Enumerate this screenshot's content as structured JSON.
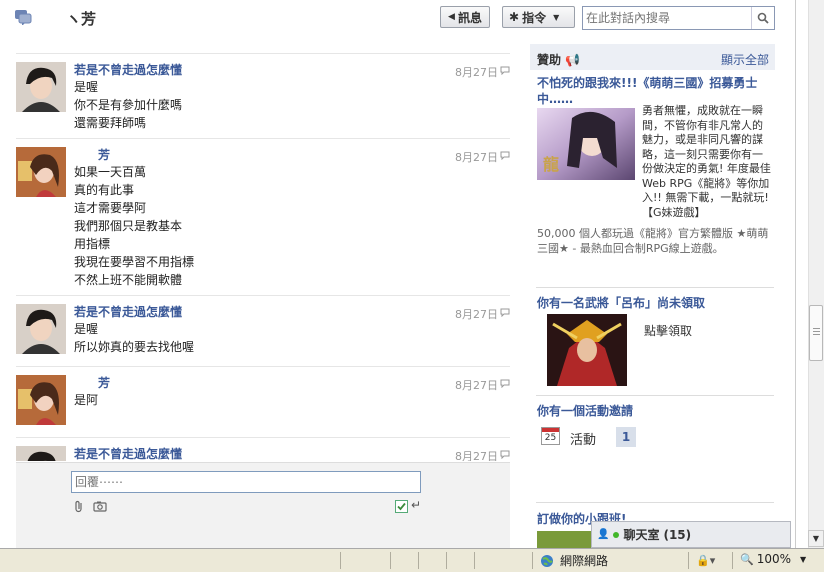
{
  "header": {
    "title": "ヽ芳",
    "message_button": "訊息",
    "actions_button": "指令",
    "search_placeholder": "在此對話內搜尋"
  },
  "messages": [
    {
      "sender": "若是不曾走過怎麼懂",
      "time": "8月27日",
      "avatar": "boy",
      "lines": [
        "是喔",
        "你不是有參加什麼嗎",
        "還需要拜師嗎"
      ]
    },
    {
      "sender": "芳",
      "time": "8月27日",
      "avatar": "girl",
      "lines": [
        "如果一天百萬",
        "真的有此事",
        "這才需要學阿",
        "我們那個只是教基本",
        "用指標",
        "我現在要學習不用指標",
        "不然上班不能開軟體"
      ]
    },
    {
      "sender": "若是不曾走過怎麼懂",
      "time": "8月27日",
      "avatar": "boy",
      "lines": [
        "是喔",
        "所以妳真的要去找他喔"
      ]
    },
    {
      "sender": "芳",
      "time": "8月27日",
      "avatar": "girl",
      "lines": [
        "是阿"
      ]
    },
    {
      "sender": "若是不曾走過怎麼懂",
      "time": "8月27日",
      "avatar": "boy",
      "lines": []
    }
  ],
  "composer": {
    "placeholder": "回覆⋯⋯"
  },
  "sponsored": {
    "title": "贊助",
    "show_all": "顯示全部",
    "ads": [
      {
        "title": "不怕死的跟我來!!!《萌萌三國》招募勇士中……",
        "body": "勇者無懼，成敗就在一瞬間，不管你有非凡常人的魅力，或是非同凡響的謀略，這一刻只需要你有一份做決定的勇氣! 年度最佳Web RPG《龍將》等你加入!! 無需下載，一點就玩!【G妹遊戲】",
        "footer": "50,000 個人都玩過《龍將》官方繁體版 ★萌萌三國★ - 最熱血回合制RPG線上遊戲。"
      },
      {
        "title": "你有一名武將「呂布」尚未領取",
        "body": "點擊領取"
      },
      {
        "title": "你有一個活動邀請",
        "event_label": "活動",
        "event_count": "1",
        "calendar_day": "25"
      },
      {
        "title": "訂做你的小跟班!"
      }
    ]
  },
  "chat": {
    "label": "聊天室",
    "count": "(15)"
  },
  "statusbar": {
    "zone": "網際網路",
    "zoom": "100%"
  },
  "colors": {
    "link": "#3b5998",
    "accent_bg": "#eceff5",
    "status_bar": "#ece9d8"
  }
}
